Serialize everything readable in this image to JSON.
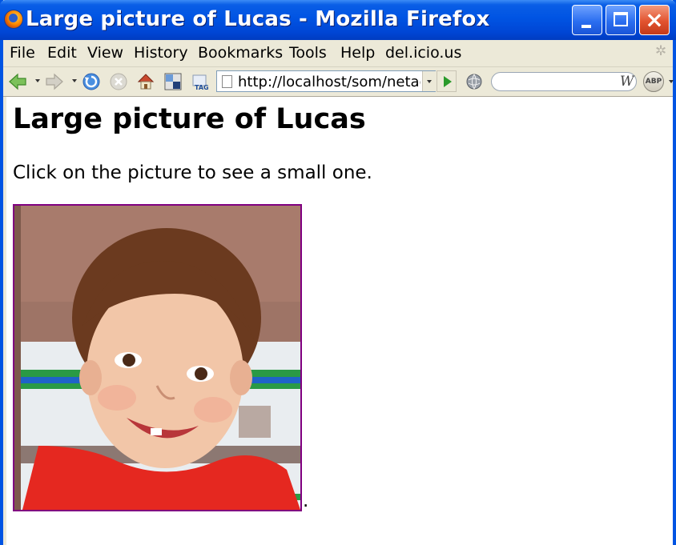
{
  "window": {
    "title": "Large picture of Lucas - Mozilla Firefox"
  },
  "menu": [
    "File",
    "Edit",
    "View",
    "History",
    "Bookmarks",
    "Tools",
    "Help",
    "del.icio.us"
  ],
  "navbar": {
    "url": "http://localhost/som/netaccess/large-picture.html",
    "search_placeholder": "",
    "adblock_label": "ABP",
    "wiki_label": "W"
  },
  "page": {
    "heading": "Large picture of Lucas",
    "description": "Click on the picture to see a small one.",
    "trailing_text": "."
  },
  "colors": {
    "titlebar": "#0054e3",
    "chrome": "#ece9d8",
    "visited_link_border": "#800080"
  }
}
